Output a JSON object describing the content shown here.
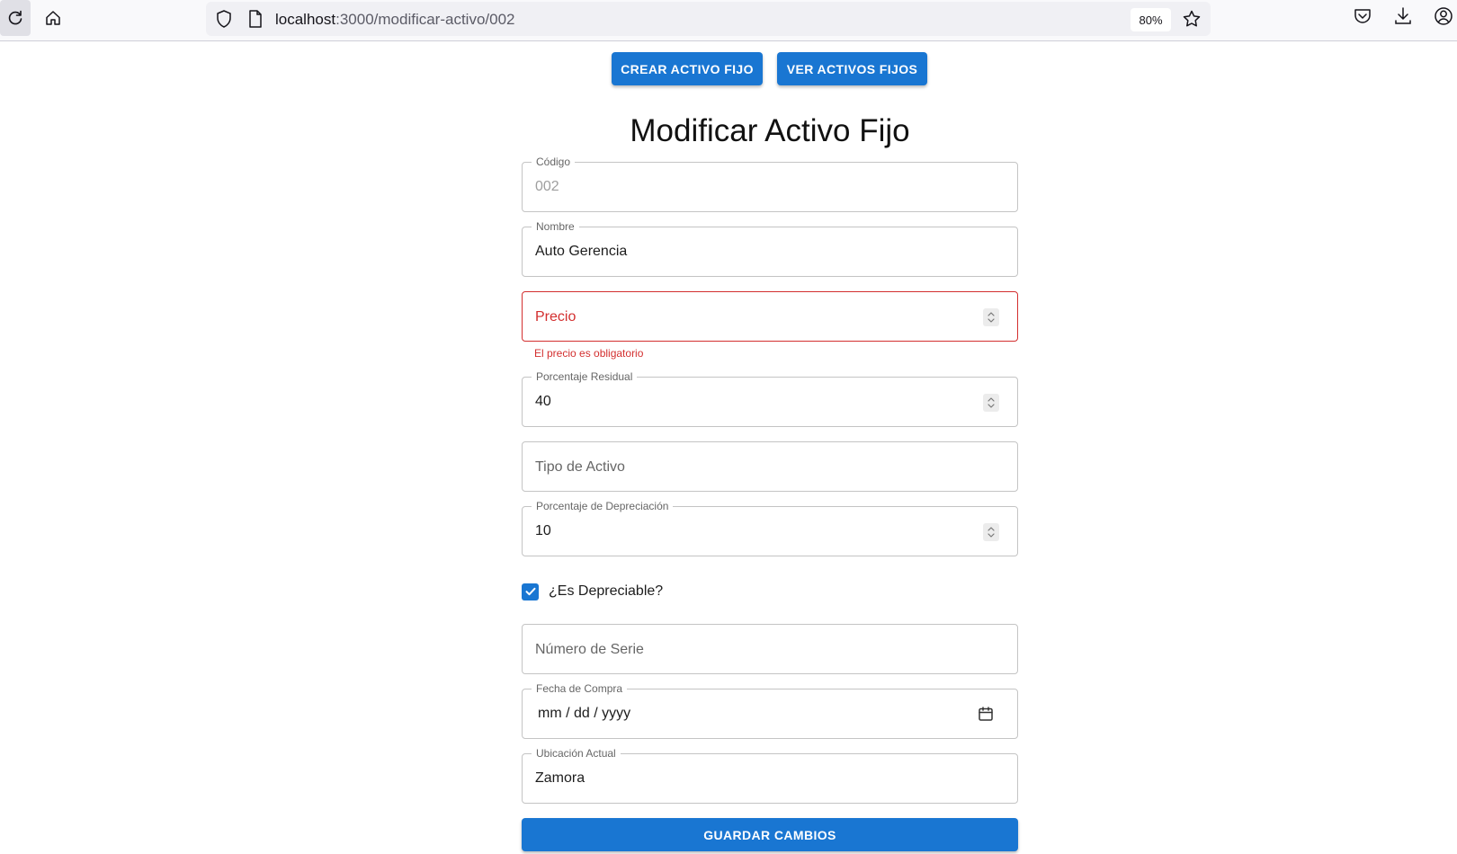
{
  "browser": {
    "url_host": "localhost",
    "url_path": ":3000/modificar-activo/002",
    "zoom": "80%",
    "icons": [
      "reload-icon",
      "home-icon",
      "shield-icon",
      "page-icon",
      "star-icon",
      "pocket-icon",
      "download-icon",
      "account-icon"
    ]
  },
  "nav": {
    "create_label": "CREAR ACTIVO FIJO",
    "view_label": "VER ACTIVOS FIJOS"
  },
  "title": "Modificar Activo Fijo",
  "form": {
    "codigo": {
      "label": "Código",
      "value": "002",
      "disabled": true
    },
    "nombre": {
      "label": "Nombre",
      "value": "Auto Gerencia"
    },
    "precio": {
      "placeholder": "Precio",
      "error": "El precio es obligatorio"
    },
    "porcentaje_residual": {
      "label": "Porcentaje Residual",
      "value": "40"
    },
    "tipo_activo": {
      "placeholder": "Tipo de Activo"
    },
    "porcentaje_depreciacion": {
      "label": "Porcentaje de Depreciación",
      "value": "10"
    },
    "es_depreciable": {
      "label": "¿Es Depreciable?",
      "checked": true
    },
    "numero_serie": {
      "placeholder": "Número de Serie"
    },
    "fecha_compra": {
      "label": "Fecha de Compra",
      "value": "mm / dd / yyyy"
    },
    "ubicacion_actual": {
      "label": "Ubicación Actual",
      "value": "Zamora"
    },
    "save_label": "GUARDAR CAMBIOS"
  },
  "colors": {
    "primary": "#1976d2",
    "error": "#d32f2f",
    "border": "#c4c4c4"
  }
}
